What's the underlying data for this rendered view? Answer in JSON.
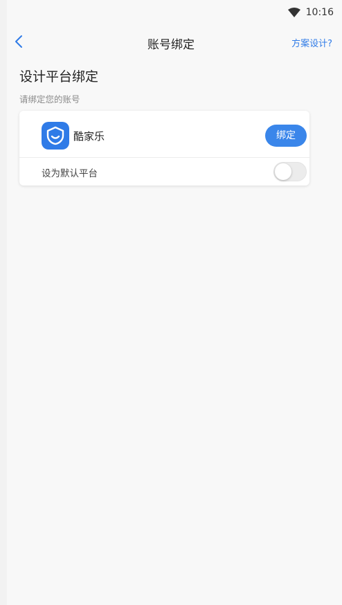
{
  "status_bar": {
    "time": "10:16",
    "wifi_icon": "wifi-icon"
  },
  "nav": {
    "back_icon": "chevron-left-icon",
    "title": "账号绑定",
    "action_label": "方案设计?",
    "action_color": "#2f7be7"
  },
  "section": {
    "title": "设计平台绑定",
    "subtitle": "请绑定您的账号"
  },
  "platform": {
    "name": "酷家乐",
    "logo_icon": "shield-smile-icon",
    "bind_label": "绑定",
    "bind_color": "#3a86ea",
    "default_label": "设为默认平台",
    "default_enabled": false
  }
}
